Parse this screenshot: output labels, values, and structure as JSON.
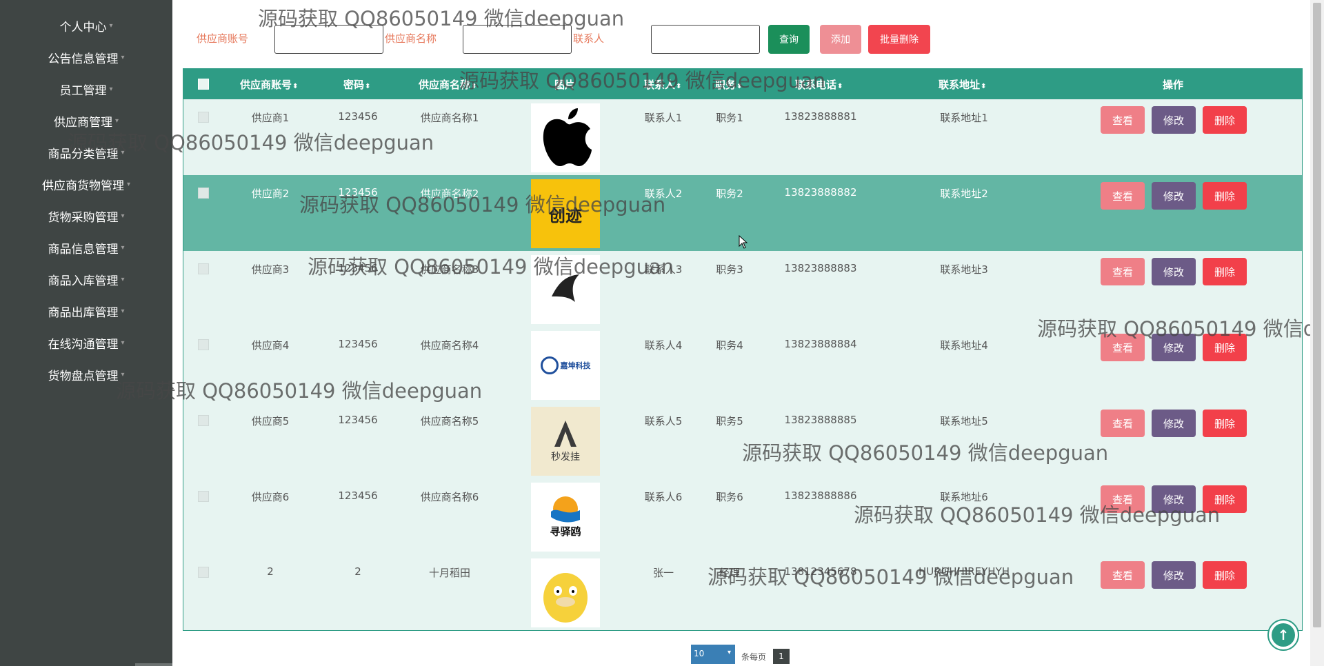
{
  "sidebar": {
    "items": [
      {
        "label": "个人中心"
      },
      {
        "label": "公告信息管理"
      },
      {
        "label": "员工管理"
      },
      {
        "label": "供应商管理"
      },
      {
        "label": "商品分类管理"
      },
      {
        "label": "供应商货物管理"
      },
      {
        "label": "货物采购管理"
      },
      {
        "label": "商品信息管理"
      },
      {
        "label": "商品入库管理"
      },
      {
        "label": "商品出库管理"
      },
      {
        "label": "在线沟通管理"
      },
      {
        "label": "货物盘点管理"
      }
    ]
  },
  "search": {
    "account_label": "供应商账号",
    "name_label": "供应商名称",
    "contact_label": "联系人",
    "query_button": "查询",
    "add_button": "添加",
    "batch_delete_button": "批量删除"
  },
  "table": {
    "headers": {
      "account": "供应商账号",
      "password": "密码",
      "name": "供应商名称",
      "image": "图片",
      "contact": "联系人",
      "position": "职务",
      "phone": "联系电话",
      "address": "联系地址",
      "actions": "操作"
    },
    "sort_glyph": "⬍",
    "action_labels": {
      "view": "查看",
      "edit": "修改",
      "delete": "删除"
    },
    "rows": [
      {
        "account": "供应商1",
        "password": "123456",
        "name": "供应商名称1",
        "contact": "联系人1",
        "position": "职务1",
        "phone": "13823888881",
        "address": "联系地址1",
        "image_icon": "apple-logo",
        "image_text": ""
      },
      {
        "account": "供应商2",
        "password": "123456",
        "name": "供应商名称2",
        "contact": "联系人2",
        "position": "职务2",
        "phone": "13823888882",
        "address": "联系地址2",
        "image_icon": "yellow-brand-logo",
        "image_text": "创迹"
      },
      {
        "account": "供应商3",
        "password": "123456",
        "name": "供应商名称3",
        "contact": "联系人3",
        "position": "职务3",
        "phone": "13823888883",
        "address": "联系地址3",
        "image_icon": "bird-brand-logo",
        "image_text": ""
      },
      {
        "account": "供应商4",
        "password": "123456",
        "name": "供应商名称4",
        "contact": "联系人4",
        "position": "职务4",
        "phone": "13823888884",
        "address": "联系地址4",
        "image_icon": "tech-company-logo",
        "image_text": "嘉坤科技"
      },
      {
        "account": "供应商5",
        "password": "123456",
        "name": "供应商名称5",
        "contact": "联系人5",
        "position": "职务5",
        "phone": "13823888885",
        "address": "联系地址5",
        "image_icon": "calligraphy-logo",
        "image_text": "秒发挂"
      },
      {
        "account": "供应商6",
        "password": "123456",
        "name": "供应商名称6",
        "contact": "联系人6",
        "position": "职务6",
        "phone": "13823888886",
        "address": "联系地址6",
        "image_icon": "wave-brand-logo",
        "image_text": "寻驿鸥"
      },
      {
        "account": "2",
        "password": "2",
        "name": "十月稻田",
        "contact": "张一",
        "position": "经理",
        "phone": "13812345678",
        "address": "HURGHHIREYHYH",
        "image_icon": "yellow-duck-avatar",
        "image_text": ""
      }
    ]
  },
  "pagination": {
    "page_size": "10",
    "per_page_label": "条每页",
    "current_page": "1"
  },
  "watermark": "源码获取 QQ86050149 微信deepguan",
  "colors": {
    "sidebar_bg": "#3f4544",
    "header_bg": "#2e9c85",
    "row_bg": "#e7f4f1",
    "row_hover_bg": "#63b6a4",
    "query_btn": "#1b8f5a",
    "add_btn": "#ee8f95",
    "delete_btn": "#f2404a",
    "edit_btn": "#6c5b87",
    "label_orange": "#e6785b"
  }
}
